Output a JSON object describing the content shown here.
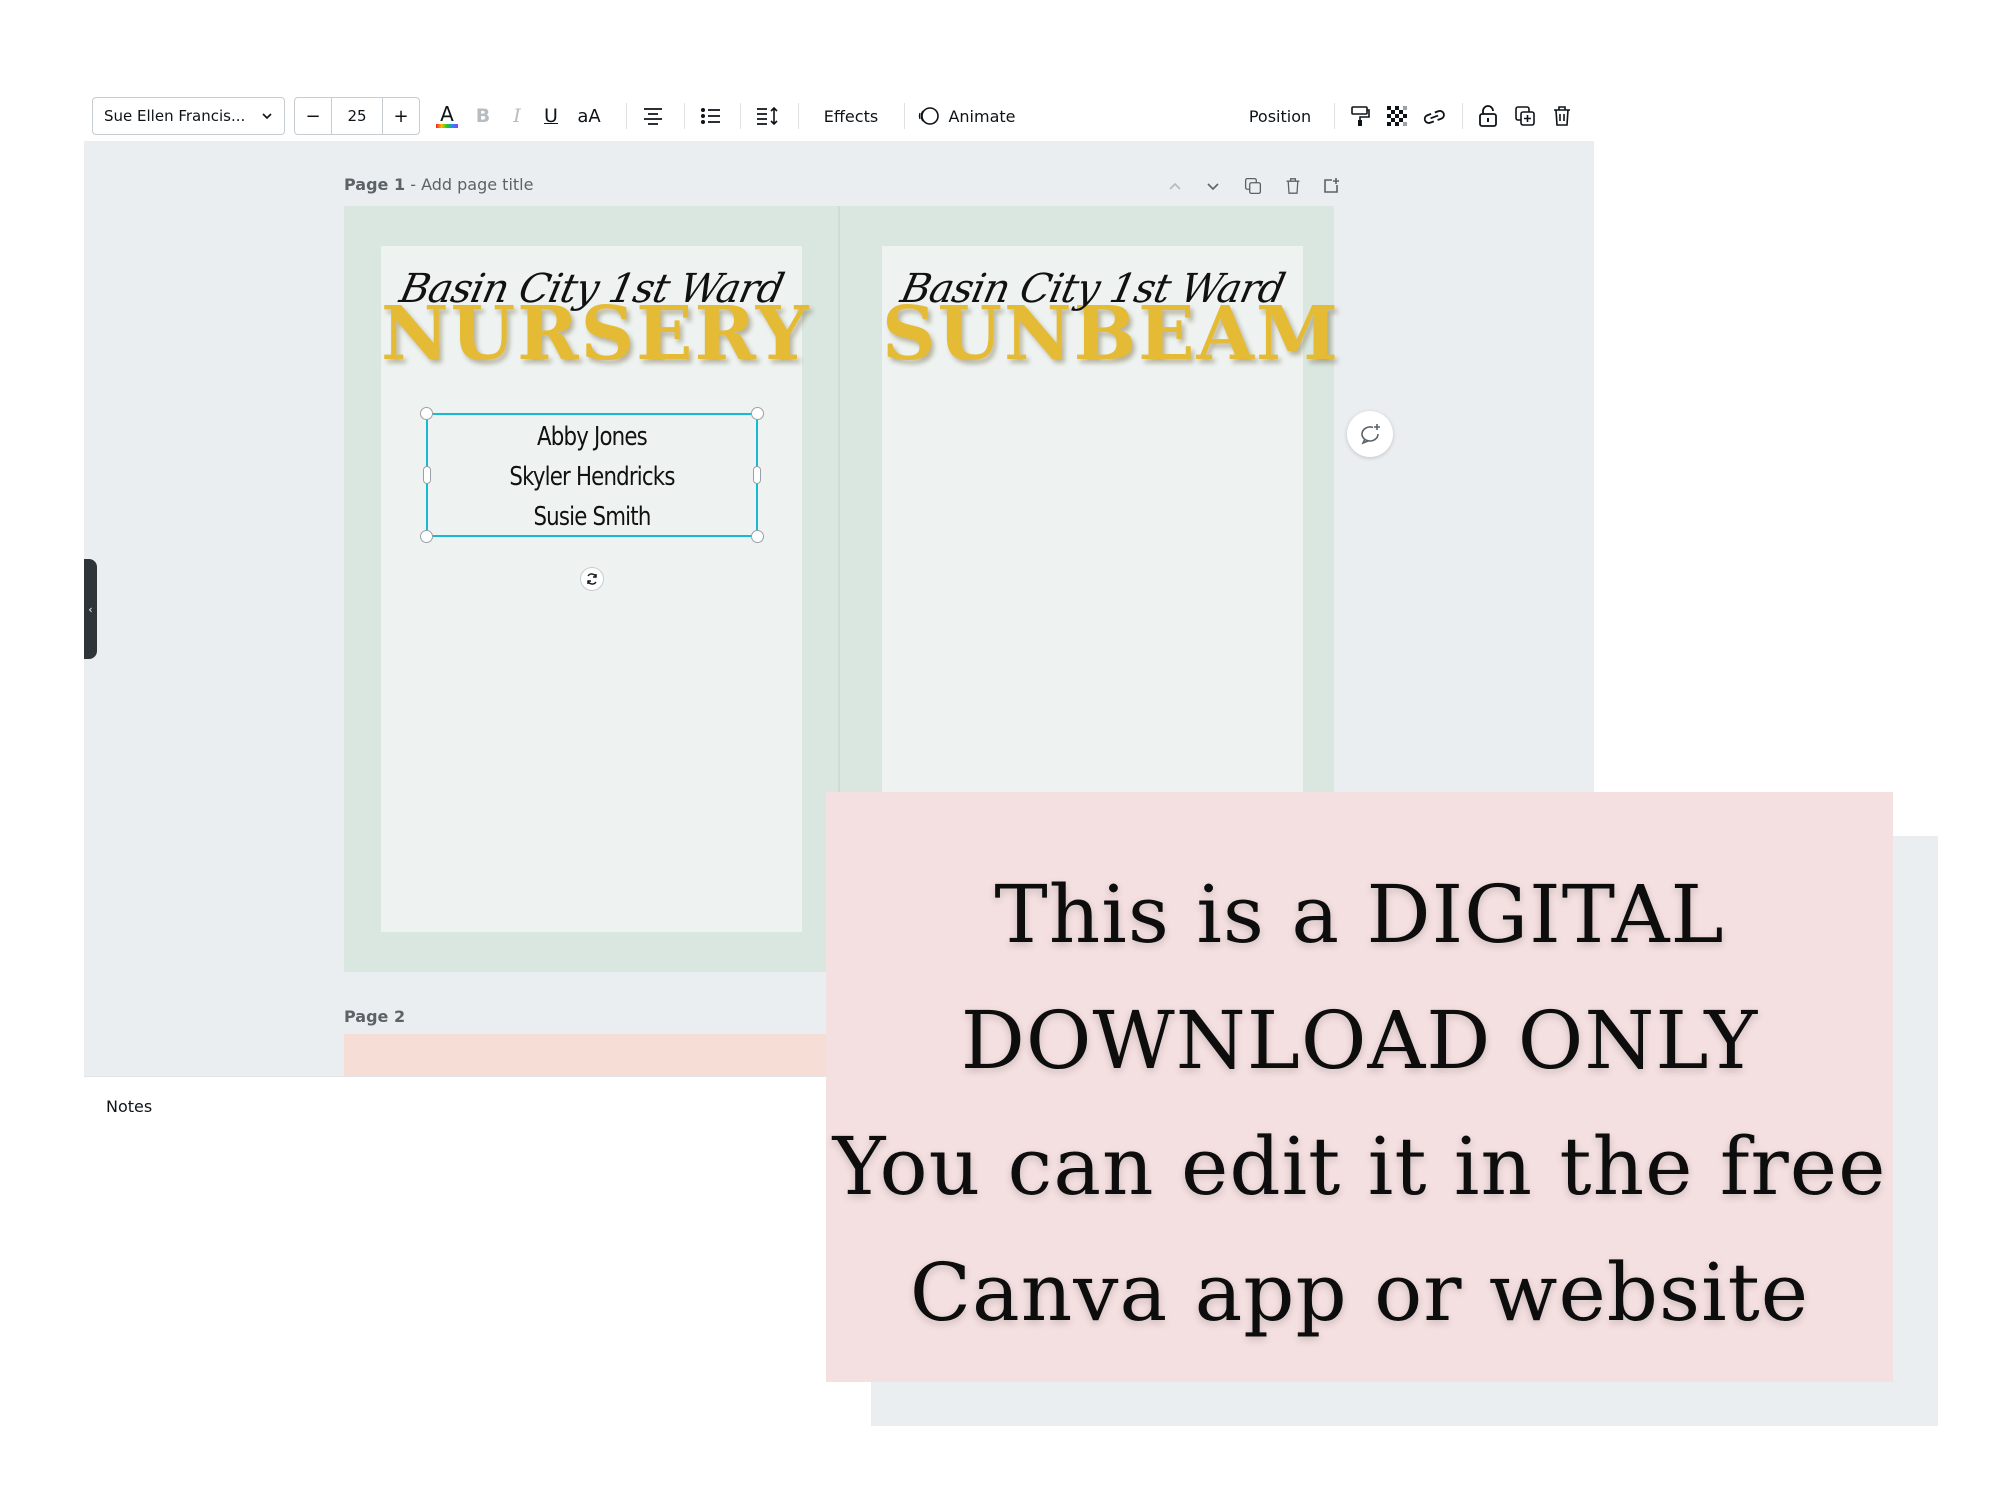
{
  "toolbar": {
    "font_name": "Sue Ellen Francis...",
    "font_size": "25",
    "minus": "−",
    "plus": "+",
    "text_color_glyph": "A",
    "bold_glyph": "B",
    "italic_glyph": "I",
    "underline_glyph": "U",
    "case_glyph": "aA",
    "effects_label": "Effects",
    "animate_label": "Animate",
    "position_label": "Position"
  },
  "page1": {
    "label": "Page 1",
    "title_placeholder": "- Add page title",
    "cards": [
      {
        "subtitle": "Basin City 1st Ward",
        "title": "NURSERY"
      },
      {
        "subtitle": "Basin City 1st Ward",
        "title": "SUNBEAM"
      }
    ],
    "names": [
      "Abby Jones",
      "Skyler Hendricks",
      "Susie Smith"
    ]
  },
  "page2": {
    "label": "Page 2"
  },
  "notes": {
    "label": "Notes"
  },
  "sidebar_toggle": "‹",
  "banner": {
    "lines": [
      "This is a DIGITAL",
      "DOWNLOAD ONLY",
      "You can edit it in the free",
      "Canva app or website"
    ]
  },
  "colors": {
    "accent_selection": "#19b8d4",
    "title_gold": "#e5bb35",
    "page_bg": "#d9e7e0",
    "banner_bg": "#f5e0e1"
  },
  "icons": [
    "chevron-down-icon",
    "text-color-icon",
    "align-center-icon",
    "bullet-list-icon",
    "line-spacing-icon",
    "animate-icon",
    "paint-format-icon",
    "transparency-icon",
    "link-icon",
    "lock-icon",
    "duplicate-icon",
    "trash-icon",
    "chevron-up-icon",
    "add-page-icon",
    "rotate-icon",
    "add-comment-icon"
  ]
}
